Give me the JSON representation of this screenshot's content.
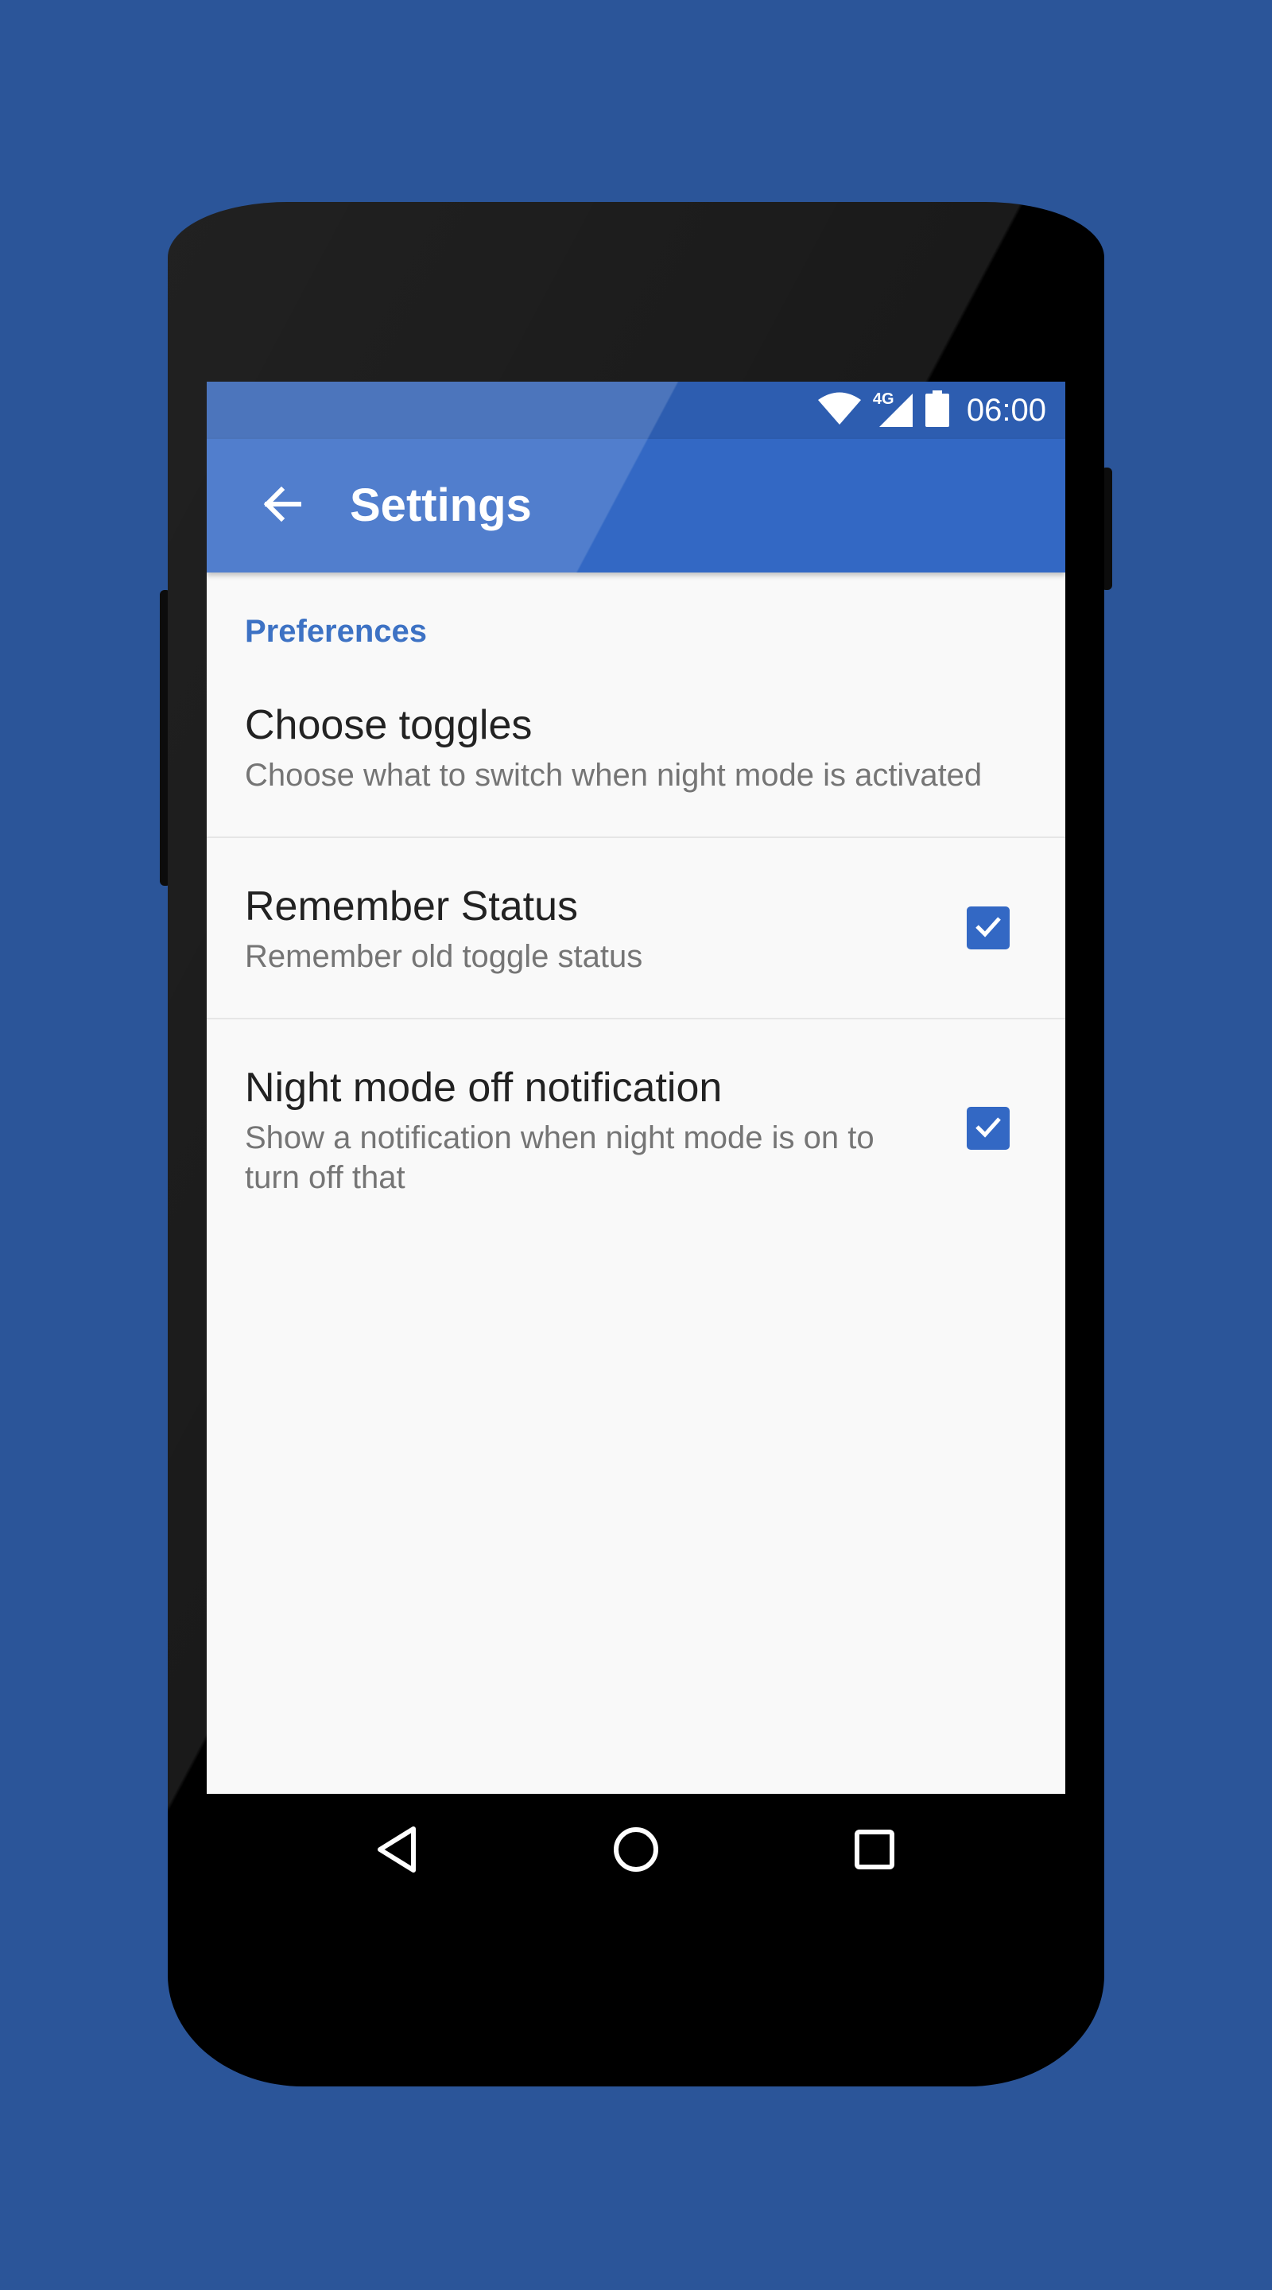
{
  "colors": {
    "background": "#2b5599",
    "primary": "#3368c4",
    "primary_dark": "#2d5db0",
    "accent": "#3d72c4"
  },
  "status_bar": {
    "time": "06:00",
    "network": "4G",
    "icons": [
      "wifi-icon",
      "cellular-signal-icon",
      "battery-icon"
    ]
  },
  "app_bar": {
    "back_icon": "arrow-back-icon",
    "title": "Settings"
  },
  "preferences": {
    "category": "Preferences",
    "items": [
      {
        "title": "Choose toggles",
        "summary": "Choose what to switch when night mode is activated",
        "has_checkbox": false
      },
      {
        "title": "Remember Status",
        "summary": "Remember old toggle status",
        "has_checkbox": true,
        "checked": true
      },
      {
        "title": "Night mode off notification",
        "summary": "Show a notification when night mode is on to turn off that",
        "has_checkbox": true,
        "checked": true
      }
    ]
  },
  "nav_bar": {
    "icons": [
      "back-triangle-icon",
      "home-circle-icon",
      "recents-square-icon"
    ]
  }
}
